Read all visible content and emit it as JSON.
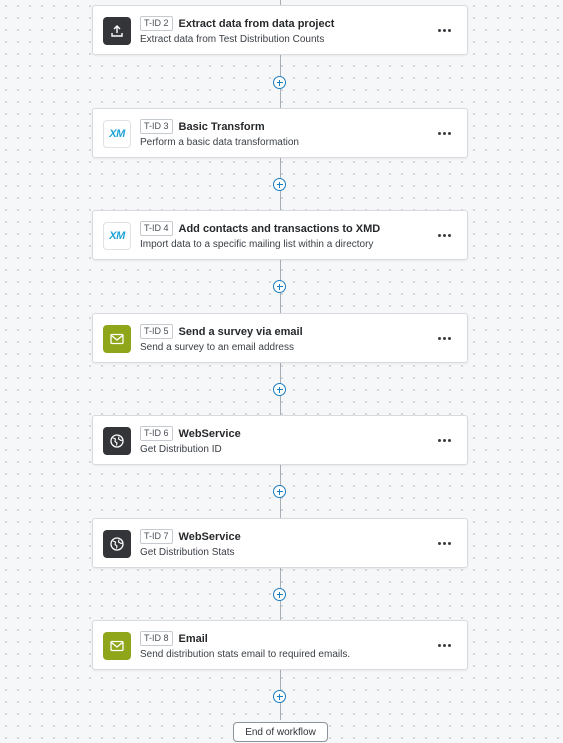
{
  "tasks": [
    {
      "tid": "T-ID 2",
      "title": "Extract data from data project",
      "subtitle": "Extract data from Test Distribution Counts",
      "icon": "upload-icon"
    },
    {
      "tid": "T-ID 3",
      "title": "Basic Transform",
      "subtitle": "Perform a basic data transformation",
      "icon": "xm-logo-icon",
      "icon_text": "XM"
    },
    {
      "tid": "T-ID 4",
      "title": "Add contacts and transactions to XMD",
      "subtitle": "Import data to a specific mailing list within a directory",
      "icon": "xm-logo-icon",
      "icon_text": "XM"
    },
    {
      "tid": "T-ID 5",
      "title": "Send a survey via email",
      "subtitle": "Send a survey to an email address",
      "icon": "email-icon"
    },
    {
      "tid": "T-ID 6",
      "title": "WebService",
      "subtitle": "Get Distribution ID",
      "icon": "web-service-icon"
    },
    {
      "tid": "T-ID 7",
      "title": "WebService",
      "subtitle": "Get Distribution Stats",
      "icon": "web-service-icon"
    },
    {
      "tid": "T-ID 8",
      "title": "Email",
      "subtitle": "Send distribution stats email to required emails.",
      "icon": "email-icon"
    }
  ],
  "end_label": "End of workflow",
  "colors": {
    "dark_icon": "#333539",
    "green_icon": "#8fa51a",
    "xm_blue": "#1fa3d6",
    "add_blue": "#1b7dc2"
  }
}
